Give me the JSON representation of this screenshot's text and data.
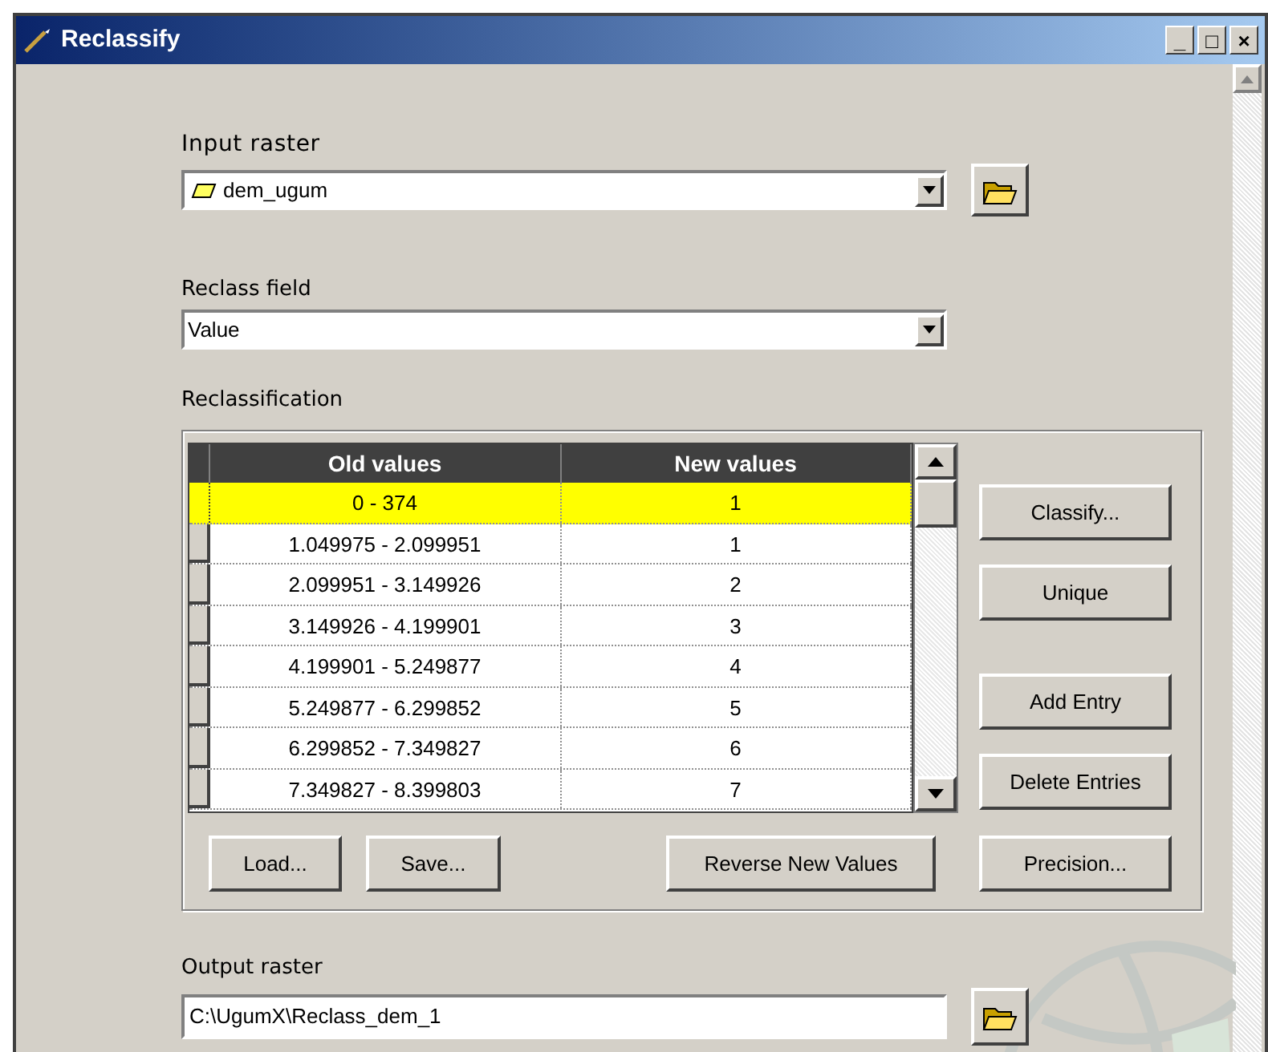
{
  "window": {
    "title": "Reclassify",
    "controls": [
      "_",
      "□",
      "×"
    ]
  },
  "input_raster": {
    "label": "Input raster",
    "value": "dem_ugum"
  },
  "reclass_field": {
    "label": "Reclass field",
    "value": "Value"
  },
  "reclassification": {
    "label": "Reclassification",
    "columns": [
      "Old values",
      "New values"
    ],
    "rows": [
      {
        "old": "0 - 374",
        "new": "1",
        "selected": true
      },
      {
        "old": "1.049975 - 2.099951",
        "new": "1",
        "selected": false
      },
      {
        "old": "2.099951 - 3.149926",
        "new": "2",
        "selected": false
      },
      {
        "old": "3.149926 - 4.199901",
        "new": "3",
        "selected": false
      },
      {
        "old": "4.199901 - 5.249877",
        "new": "4",
        "selected": false
      },
      {
        "old": "5.249877 - 6.299852",
        "new": "5",
        "selected": false
      },
      {
        "old": "6.299852 - 7.349827",
        "new": "6",
        "selected": false
      },
      {
        "old": "7.349827 - 8.399803",
        "new": "7",
        "selected": false
      }
    ],
    "side_buttons": [
      "Classify...",
      "Unique",
      "Add Entry",
      "Delete Entries"
    ],
    "bottom_buttons": [
      "Load...",
      "Save...",
      "Reverse New Values",
      "Precision..."
    ]
  },
  "output_raster": {
    "label": "Output raster",
    "value": "C:\\UgumX\\Reclass_dem_1"
  }
}
